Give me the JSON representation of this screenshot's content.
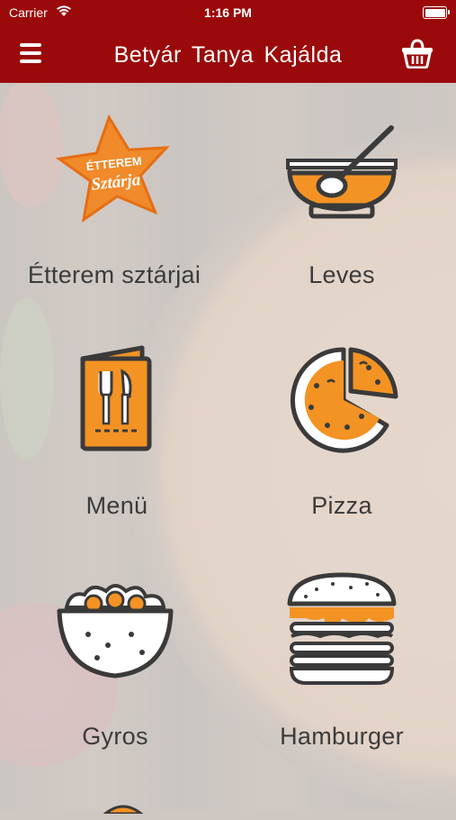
{
  "status_bar": {
    "carrier": "Carrier",
    "time": "1:16 PM"
  },
  "nav": {
    "title": "Betyár Tanya Kajálda",
    "menu_icon": "hamburger-menu-icon",
    "cart_icon": "basket-icon"
  },
  "badge": {
    "line1": "ÉTTEREM",
    "line2": "Sztárja"
  },
  "categories": [
    {
      "label": "Étterem sztárjai",
      "icon": "star-badge-icon"
    },
    {
      "label": "Leves",
      "icon": "soup-bowl-icon"
    },
    {
      "label": "Menü",
      "icon": "menu-card-icon"
    },
    {
      "label": "Pizza",
      "icon": "pizza-icon"
    },
    {
      "label": "Gyros",
      "icon": "gyros-bowl-icon"
    },
    {
      "label": "Hamburger",
      "icon": "burger-icon"
    }
  ],
  "colors": {
    "header": "#9b0a0a",
    "accent": "#f39324",
    "icon_stroke": "#3a3a3a"
  }
}
